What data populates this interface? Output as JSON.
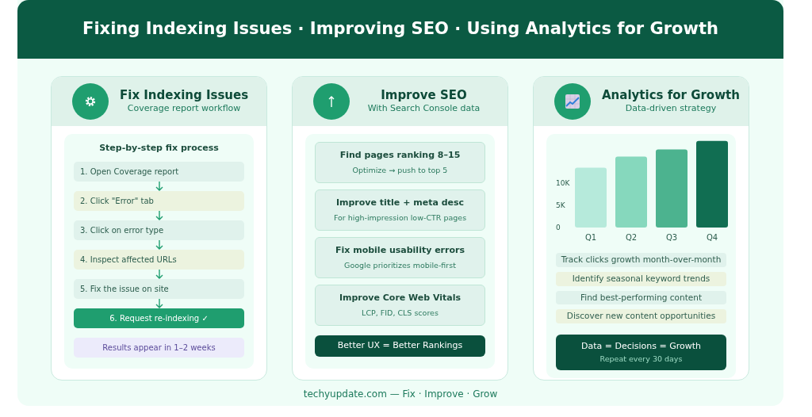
{
  "header": {
    "title": "Fixing Indexing Issues · Improving SEO · Using Analytics for Growth"
  },
  "cards": [
    {
      "kind": "steps",
      "title": "Fix Indexing Issues",
      "subtitle": "Coverage report workflow",
      "steps_title": "Step-by-step fix process",
      "steps": [
        {
          "text": "1. Open Coverage report",
          "color": "#e0f2ec",
          "highlighted": false
        },
        {
          "text": "2. Click \"Error\" tab",
          "color": "#ecf3df",
          "highlighted": false
        },
        {
          "text": "3. Click on error type",
          "color": "#e0f2ec",
          "highlighted": false
        },
        {
          "text": "4. Inspect affected URLs",
          "color": "#ecf3df",
          "highlighted": false
        },
        {
          "text": "5. Fix the issue on site",
          "color": "#e0f2ec",
          "highlighted": false
        },
        {
          "text": "6. Request re-indexing ✓",
          "color": "#1f9e6f",
          "highlighted": true
        }
      ],
      "note": "Results appear in 1–2 weeks"
    },
    {
      "kind": "tips",
      "title": "Improve SEO",
      "subtitle": "With Search Console data",
      "tips": [
        {
          "title": "Find pages ranking 8–15",
          "detail": "Optimize → push to top 5"
        },
        {
          "title": "Improve title + meta desc",
          "detail": "For high-impression low-CTR pages"
        },
        {
          "title": "Fix mobile usability errors",
          "detail": "Google prioritizes mobile-first"
        },
        {
          "title": "Improve Core Web Vitals",
          "detail": "LCP, FID, CLS scores"
        }
      ],
      "banner": "Better UX = Better Rankings"
    },
    {
      "kind": "analytics",
      "title": "Analytics for Growth",
      "subtitle": "Data-driven strategy",
      "chart_data": {
        "type": "bar",
        "categories": [
          "Q1",
          "Q2",
          "Q3",
          "Q4"
        ],
        "values": [
          13500,
          16000,
          17600,
          19500
        ],
        "ylim": [
          0,
          20000
        ],
        "yticks": [
          0,
          {
            "value": 5000,
            "label": "5K"
          },
          {
            "value": 10000,
            "label": "10K"
          }
        ]
      },
      "items": [
        {
          "text": "Track clicks growth month-over-month",
          "color": "#e0f2ec"
        },
        {
          "text": "Identify seasonal keyword trends",
          "color": "#ecf3df"
        },
        {
          "text": "Find best-performing content",
          "color": "#e0f2ec"
        },
        {
          "text": "Discover new content opportunities",
          "color": "#ecf3df"
        }
      ],
      "banner": {
        "title": "Data = Decisions = Growth",
        "subtitle": "Repeat every 30 days"
      }
    }
  ],
  "footer": "techyupdate.com — Fix · Improve · Grow"
}
